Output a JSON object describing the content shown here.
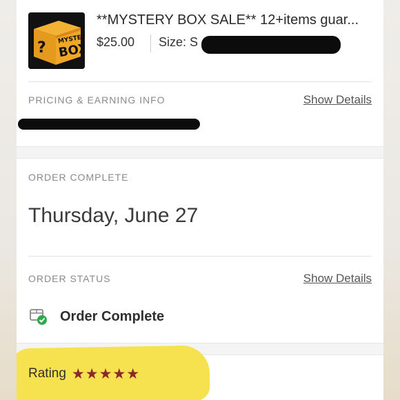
{
  "product": {
    "title": "**MYSTERY BOX SALE** 12+items guar...",
    "price": "$25.00",
    "size_label": "Size: S",
    "thumb_text_top": "MYSTERY",
    "thumb_text_bottom": "BOX",
    "thumb_mark": "?"
  },
  "pricing": {
    "label": "PRICING & EARNING INFO",
    "details_link": "Show Details"
  },
  "order_complete": {
    "label": "ORDER COMPLETE",
    "date": "Thursday, June 27"
  },
  "order_status": {
    "label": "ORDER STATUS",
    "details_link": "Show Details",
    "status_icon": "package-check-icon",
    "status_text": "Order Complete"
  },
  "rating": {
    "label": "Rating",
    "stars": [
      "★",
      "★",
      "★",
      "★",
      "★"
    ],
    "value": 5,
    "max": 5,
    "star_color": "#8e2630"
  },
  "colors": {
    "status_check": "#2ea84a",
    "highlight": "#f6df44"
  }
}
